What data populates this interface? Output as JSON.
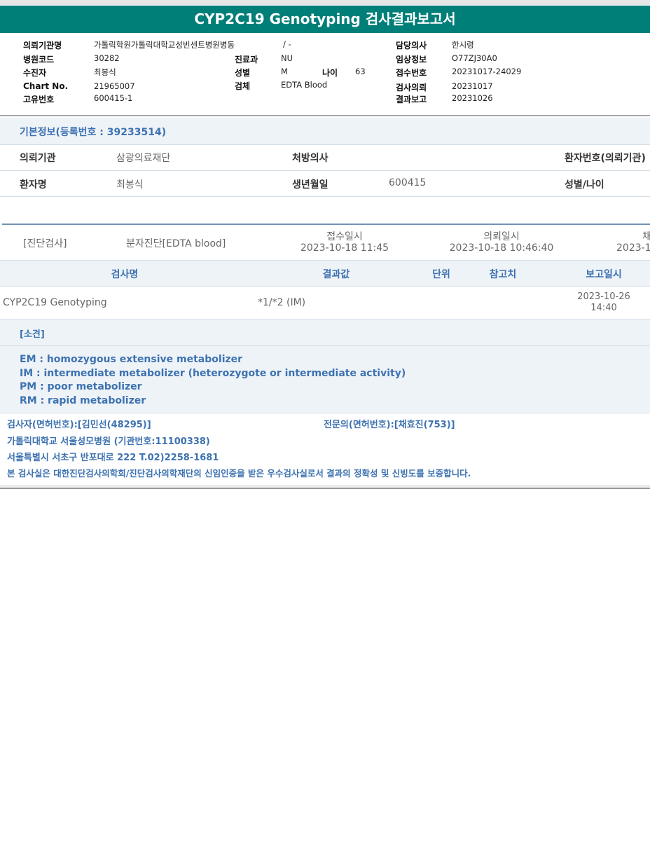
{
  "title": "CYP2C19 Genotyping 검사결과보고서",
  "header": {
    "institution_label": "의뢰기관명",
    "institution": "가톨릭학원가톨릭대학교성빈센트병원병동",
    "ward": "/ -",
    "hospital_code_label": "병원코드",
    "hospital_code": "30282",
    "patient_label": "수진자",
    "patient": "최봉식",
    "chart_label": "Chart No.",
    "chart": "21965007",
    "unique_label": "고유번호",
    "unique": "600415-1",
    "dept_label": "진료과",
    "dept": "NU",
    "sex_label": "성별",
    "sex": "M",
    "age_label": "나이",
    "age": "63",
    "specimen_label": "검체",
    "specimen": "EDTA Blood",
    "doctor_label": "담당의사",
    "doctor": "한시령",
    "clinical_label": "임상정보",
    "clinical": "O77ZJ30A0",
    "receipt_label": "접수번호",
    "receipt": "20231017-24029",
    "request_label": "검사의뢰",
    "request": "20231017",
    "report_label": "결과보고",
    "report": "20231026"
  },
  "basic": {
    "title": "기본정보(등록번호 : 39233514)",
    "ref_inst_label": "의뢰기관",
    "ref_inst": "삼광의료재단",
    "prescriber_label": "처방의사",
    "prescriber": "",
    "patient_no_label": "환자번호(의뢰기관)",
    "name_label": "환자명",
    "name": "최봉식",
    "dob_label": "생년월일",
    "dob": "600415",
    "sexage_label": "성별/나이"
  },
  "exam": {
    "category": "[진단검사]",
    "type": "분자진단[EDTA blood]",
    "received_label": "접수일시",
    "received": "2023-10-18 11:45",
    "requested_label": "의뢰일시",
    "requested": "2023-10-18 10:46:40",
    "third_label": "채",
    "third": "2023-1"
  },
  "table": {
    "headers": [
      "검사명",
      "결과값",
      "단위",
      "참고치",
      "보고일시"
    ],
    "rows": [
      {
        "name": "CYP2C19 Genotyping",
        "result": "*1/*2 (IM)",
        "unit": "",
        "ref": "",
        "date": "2023-10-26",
        "time": "14:40"
      }
    ]
  },
  "remarks": {
    "title": "[소견]",
    "lines": [
      "EM : homozygous extensive metabolizer",
      "IM  : intermediate metabolizer (heterozygote or intermediate activity)",
      "PM : poor metabolizer",
      "RM : rapid metabolizer"
    ]
  },
  "footer": {
    "tester": "검사자(면허번호):[김민선(48295)]",
    "specialist": "전문의(면허번호):[채효진(753)]",
    "hospital": "가톨릭대학교 서울성모병원 (기관번호:11100338)",
    "address": "서울특별시 서초구 반포대로 222 T.02)2258-1681",
    "certification": "본 검사실은 대한진단검사의학회/진단검사의학재단의 신임인증을 받은 우수검사실로서 결과의 정확성 및 신빙도를 보증합니다."
  }
}
